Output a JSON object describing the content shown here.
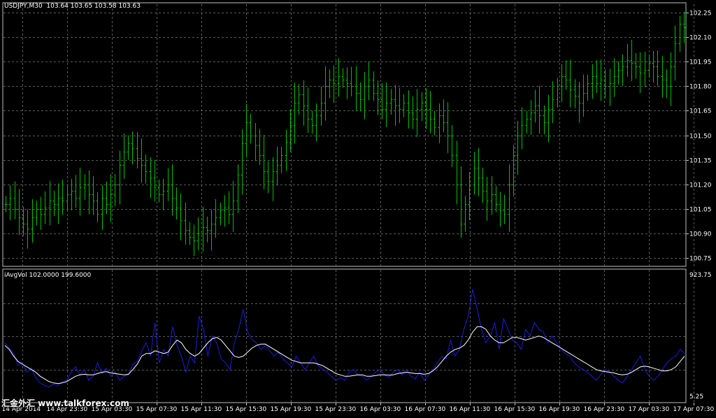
{
  "colors": {
    "background": "#000000",
    "grid": "#5b5b5b",
    "frame": "#c0c0c0",
    "bars": "#00c000",
    "volume_line": "#1d1dd8",
    "average_line": "#ffffff",
    "text": "#ffffff"
  },
  "price_pane": {
    "title": "USDJPY,M30  103.64 103.65 103.58 103.63"
  },
  "indicator_pane": {
    "title": "iAvgVol 102.0000 199.6000"
  },
  "watermark": {
    "text": "汇金外汇 www.talkforex.com"
  },
  "chart_data": [
    {
      "type": "ohlc",
      "name": "USDJPY,M30",
      "y_axis_ticks": [
        "102.25",
        "102.10",
        "101.95",
        "101.80",
        "101.65",
        "101.50",
        "101.35",
        "101.20",
        "101.05",
        "100.90",
        "100.75"
      ],
      "ylim": [
        100.7,
        102.3
      ],
      "grid": true,
      "close": [
        101.08,
        101.12,
        101.05,
        101.0,
        100.96,
        100.93,
        101.0,
        101.05,
        101.02,
        101.06,
        101.1,
        101.08,
        101.12,
        101.1,
        101.14,
        101.16,
        101.12,
        101.18,
        101.2,
        101.14,
        101.1,
        101.02,
        101.12,
        101.08,
        101.14,
        101.2,
        101.32,
        101.4,
        101.45,
        101.42,
        101.36,
        101.32,
        101.28,
        101.24,
        101.18,
        101.14,
        101.16,
        101.2,
        101.12,
        101.06,
        100.98,
        100.92,
        100.88,
        100.86,
        100.9,
        100.94,
        100.92,
        100.96,
        101.0,
        101.04,
        101.06,
        101.02,
        101.1,
        101.26,
        101.45,
        101.58,
        101.5,
        101.44,
        101.38,
        101.28,
        101.22,
        101.28,
        101.32,
        101.38,
        101.46,
        101.56,
        101.7,
        101.75,
        101.68,
        101.6,
        101.56,
        101.62,
        101.7,
        101.8,
        101.84,
        101.82,
        101.86,
        101.84,
        101.82,
        101.8,
        101.76,
        101.72,
        101.8,
        101.84,
        101.76,
        101.72,
        101.66,
        101.7,
        101.72,
        101.68,
        101.66,
        101.7,
        101.64,
        101.6,
        101.66,
        101.7,
        101.66,
        101.6,
        101.55,
        101.62,
        101.58,
        101.5,
        101.38,
        101.2,
        100.96,
        101.08,
        101.2,
        101.3,
        101.24,
        101.16,
        101.1,
        101.14,
        101.08,
        101.04,
        101.02,
        101.2,
        101.38,
        101.5,
        101.56,
        101.6,
        101.64,
        101.68,
        101.62,
        101.58,
        101.66,
        101.72,
        101.8,
        101.86,
        101.84,
        101.78,
        101.74,
        101.7,
        101.76,
        101.82,
        101.86,
        101.82,
        101.84,
        101.8,
        101.82,
        101.86,
        101.9,
        101.92,
        101.96,
        101.94,
        101.92,
        101.88,
        101.9,
        101.94,
        101.92,
        101.86,
        101.84,
        101.8,
        101.92,
        102.06,
        102.18,
        102.16
      ],
      "x_tick_labels": [
        "14 Apr 2014",
        "14 Apr 23:30",
        "15 Apr 03:30",
        "15 Apr 07:30",
        "15 Apr 11:30",
        "15 Apr 15:30",
        "15 Apr 19:30",
        "15 Apr 23:30",
        "16 Apr 03:30",
        "16 Apr 07:30",
        "16 Apr 11:30",
        "16 Apr 15:30",
        "16 Apr 19:30",
        "16 Apr 23:30",
        "17 Apr 03:30",
        "17 Apr 07:30"
      ]
    },
    {
      "type": "line",
      "name": "iAvgVol",
      "y_axis_ticks": [
        "923.75",
        "5.25"
      ],
      "ylim": [
        5.25,
        923.75
      ],
      "series": [
        {
          "key": "volume",
          "values": [
            400,
            360,
            320,
            230,
            250,
            180,
            210,
            140,
            100,
            80,
            70,
            90,
            80,
            110,
            120,
            180,
            220,
            160,
            200,
            120,
            150,
            250,
            170,
            210,
            150,
            180,
            120,
            150,
            160,
            240,
            260,
            340,
            400,
            300,
            550,
            250,
            350,
            300,
            520,
            380,
            300,
            180,
            300,
            250,
            600,
            500,
            300,
            450,
            400,
            280,
            250,
            200,
            400,
            500,
            650,
            480,
            420,
            400,
            350,
            380,
            340,
            300,
            330,
            280,
            250,
            220,
            300,
            250,
            200,
            250,
            300,
            230,
            200,
            180,
            150,
            120,
            140,
            120,
            180,
            200,
            160,
            150,
            120,
            150,
            180,
            200,
            160,
            140,
            180,
            200,
            160,
            200,
            150,
            130,
            180,
            120,
            160,
            200,
            250,
            300,
            280,
            420,
            300,
            350,
            500,
            600,
            800,
            650,
            500,
            400,
            450,
            550,
            350,
            580,
            500,
            420,
            400,
            350,
            500,
            450,
            550,
            500,
            480,
            400,
            450,
            400,
            350,
            320,
            300,
            250,
            220,
            200,
            180,
            150,
            120,
            160,
            200,
            180,
            150,
            120,
            100,
            150,
            200,
            250,
            300,
            200,
            150,
            120,
            150,
            200,
            250,
            280,
            300,
            350,
            320
          ]
        },
        {
          "key": "average",
          "values": [
            380,
            350,
            300,
            260,
            240,
            220,
            200,
            180,
            150,
            130,
            110,
            100,
            95,
            100,
            110,
            130,
            150,
            160,
            165,
            160,
            160,
            170,
            180,
            185,
            175,
            170,
            165,
            160,
            165,
            200,
            240,
            300,
            320,
            320,
            340,
            330,
            320,
            330,
            380,
            420,
            400,
            350,
            320,
            300,
            320,
            360,
            400,
            430,
            440,
            420,
            380,
            340,
            300,
            290,
            300,
            330,
            360,
            380,
            390,
            390,
            370,
            350,
            330,
            310,
            290,
            270,
            260,
            250,
            250,
            250,
            250,
            240,
            230,
            210,
            190,
            170,
            160,
            150,
            150,
            155,
            160,
            160,
            150,
            150,
            155,
            160,
            160,
            158,
            160,
            170,
            175,
            180,
            175,
            170,
            170,
            165,
            170,
            190,
            220,
            260,
            300,
            330,
            350,
            360,
            380,
            420,
            480,
            520,
            520,
            500,
            450,
            420,
            400,
            400,
            420,
            440,
            440,
            430,
            420,
            430,
            440,
            450,
            440,
            420,
            400,
            380,
            360,
            340,
            320,
            300,
            280,
            260,
            240,
            220,
            200,
            190,
            185,
            180,
            175,
            165,
            160,
            165,
            180,
            200,
            220,
            225,
            220,
            210,
            200,
            190,
            190,
            200,
            220,
            260,
            300
          ]
        }
      ]
    }
  ]
}
